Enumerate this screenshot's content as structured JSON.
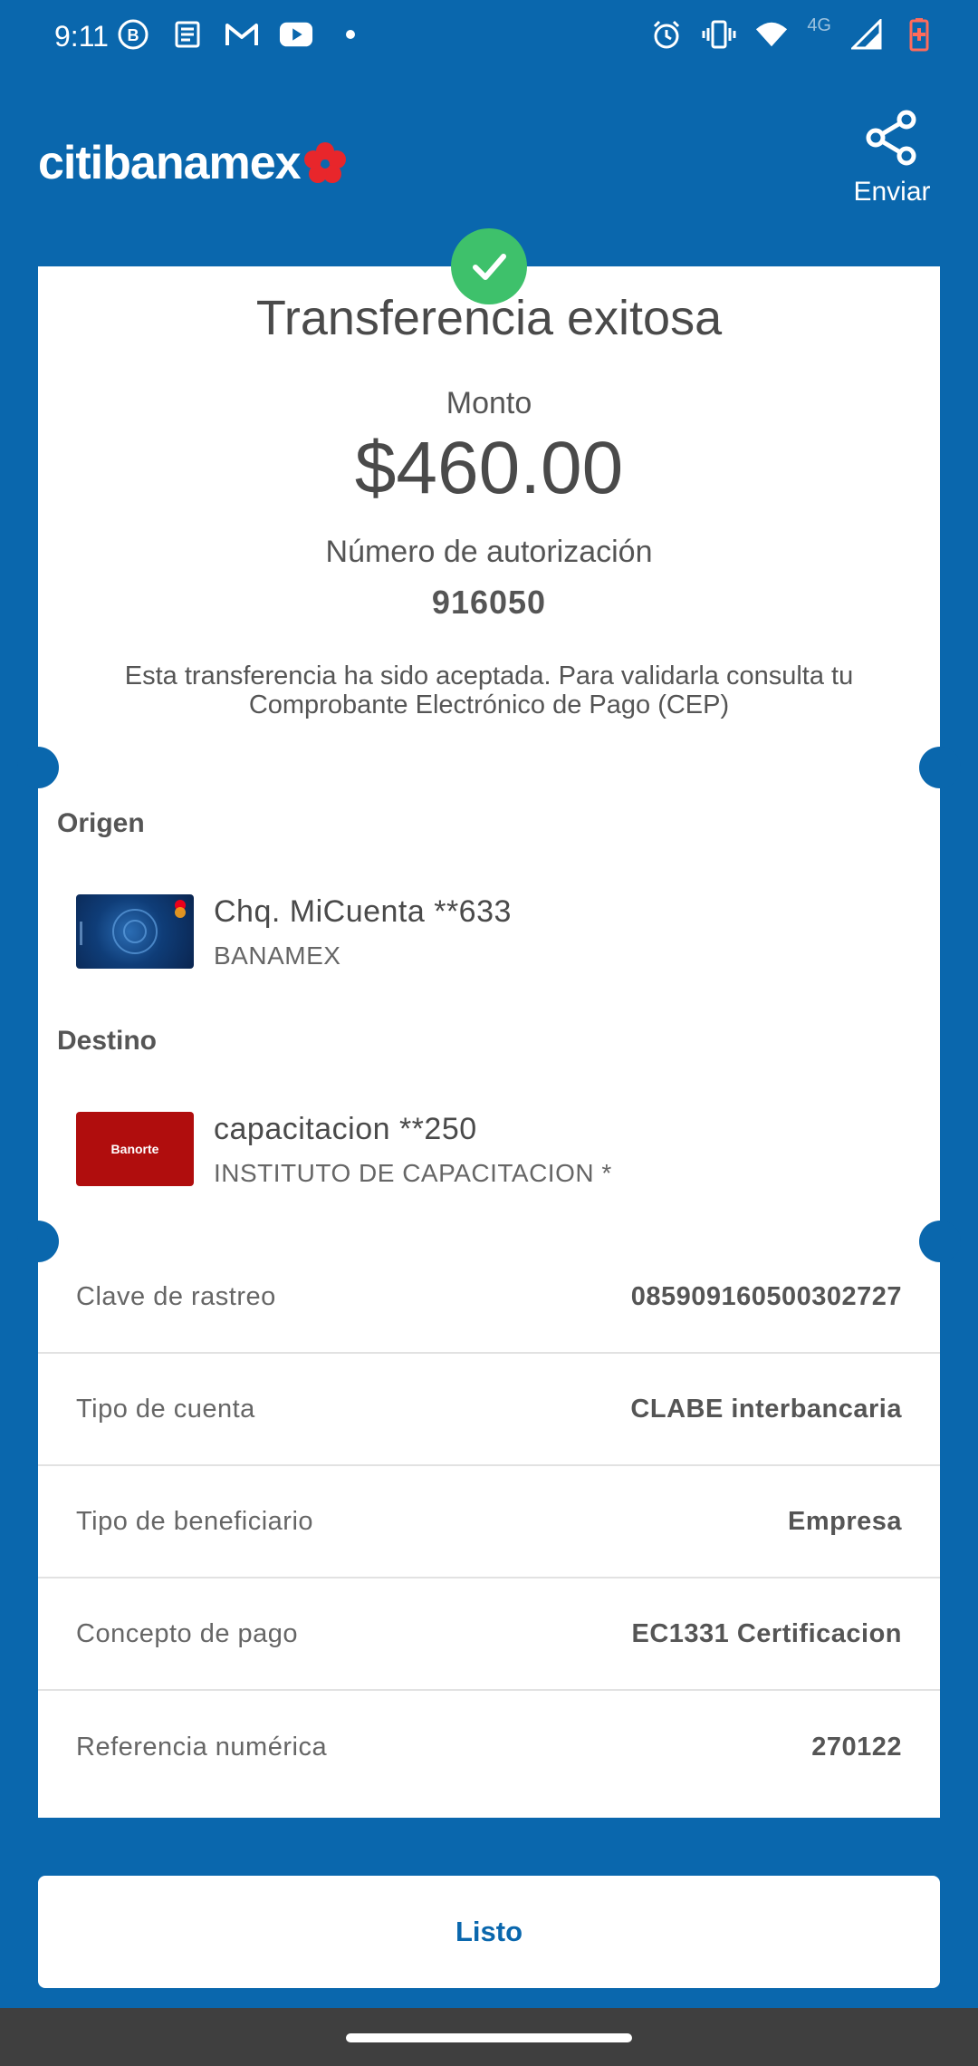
{
  "status_bar": {
    "time": "9:11",
    "network": "4G",
    "icons": [
      "b-icon",
      "news-icon",
      "gmail-icon",
      "youtube-icon",
      "dot-icon",
      "alarm-icon",
      "vibrate-icon",
      "wifi-icon",
      "signal-icon",
      "battery-icon"
    ]
  },
  "header": {
    "logo_text": "citibanamex",
    "share_label": "Enviar"
  },
  "receipt": {
    "title": "Transferencia exitosa",
    "amount_label": "Monto",
    "amount": "$460.00",
    "auth_label": "Número de autorización",
    "auth_number": "916050",
    "notice": "Esta transferencia ha sido aceptada. Para validarla consulta tu Comprobante Electrónico de Pago (CEP)"
  },
  "origin": {
    "label": "Origen",
    "account_name": "Chq. MiCuenta **633",
    "bank": "BANAMEX"
  },
  "destination": {
    "label": "Destino",
    "card_text": "Banorte",
    "account_name": "capacitacion **250",
    "holder": "INSTITUTO DE CAPACITACION *"
  },
  "details": [
    {
      "label": "Clave de rastreo",
      "value": "085909160500302727"
    },
    {
      "label": "Tipo de cuenta",
      "value": "CLABE interbancaria"
    },
    {
      "label": "Tipo de beneficiario",
      "value": "Empresa"
    },
    {
      "label": "Concepto de pago",
      "value": "EC1331 Certificacion"
    },
    {
      "label": "Referencia numérica",
      "value": "270122"
    }
  ],
  "done_button": "Listo",
  "colors": {
    "brand_blue": "#0a67ad",
    "success_green": "#3ec16b",
    "banorte_red": "#b00d0d",
    "logo_red": "#e8262b"
  }
}
